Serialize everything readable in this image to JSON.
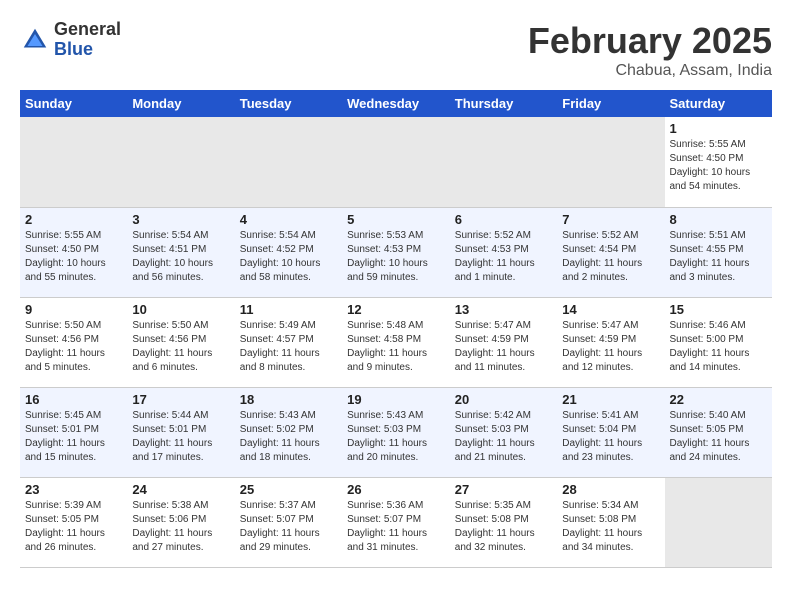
{
  "header": {
    "logo_general": "General",
    "logo_blue": "Blue",
    "month": "February 2025",
    "location": "Chabua, Assam, India"
  },
  "weekdays": [
    "Sunday",
    "Monday",
    "Tuesday",
    "Wednesday",
    "Thursday",
    "Friday",
    "Saturday"
  ],
  "weeks": [
    [
      {
        "day": "",
        "info": ""
      },
      {
        "day": "",
        "info": ""
      },
      {
        "day": "",
        "info": ""
      },
      {
        "day": "",
        "info": ""
      },
      {
        "day": "",
        "info": ""
      },
      {
        "day": "",
        "info": ""
      },
      {
        "day": "1",
        "info": "Sunrise: 5:55 AM\nSunset: 4:50 PM\nDaylight: 10 hours and 54 minutes."
      }
    ],
    [
      {
        "day": "2",
        "info": "Sunrise: 5:55 AM\nSunset: 4:50 PM\nDaylight: 10 hours and 55 minutes."
      },
      {
        "day": "3",
        "info": "Sunrise: 5:54 AM\nSunset: 4:51 PM\nDaylight: 10 hours and 56 minutes."
      },
      {
        "day": "4",
        "info": "Sunrise: 5:54 AM\nSunset: 4:52 PM\nDaylight: 10 hours and 58 minutes."
      },
      {
        "day": "5",
        "info": "Sunrise: 5:53 AM\nSunset: 4:53 PM\nDaylight: 10 hours and 59 minutes."
      },
      {
        "day": "6",
        "info": "Sunrise: 5:52 AM\nSunset: 4:53 PM\nDaylight: 11 hours and 1 minute."
      },
      {
        "day": "7",
        "info": "Sunrise: 5:52 AM\nSunset: 4:54 PM\nDaylight: 11 hours and 2 minutes."
      },
      {
        "day": "8",
        "info": "Sunrise: 5:51 AM\nSunset: 4:55 PM\nDaylight: 11 hours and 3 minutes."
      }
    ],
    [
      {
        "day": "9",
        "info": "Sunrise: 5:50 AM\nSunset: 4:56 PM\nDaylight: 11 hours and 5 minutes."
      },
      {
        "day": "10",
        "info": "Sunrise: 5:50 AM\nSunset: 4:56 PM\nDaylight: 11 hours and 6 minutes."
      },
      {
        "day": "11",
        "info": "Sunrise: 5:49 AM\nSunset: 4:57 PM\nDaylight: 11 hours and 8 minutes."
      },
      {
        "day": "12",
        "info": "Sunrise: 5:48 AM\nSunset: 4:58 PM\nDaylight: 11 hours and 9 minutes."
      },
      {
        "day": "13",
        "info": "Sunrise: 5:47 AM\nSunset: 4:59 PM\nDaylight: 11 hours and 11 minutes."
      },
      {
        "day": "14",
        "info": "Sunrise: 5:47 AM\nSunset: 4:59 PM\nDaylight: 11 hours and 12 minutes."
      },
      {
        "day": "15",
        "info": "Sunrise: 5:46 AM\nSunset: 5:00 PM\nDaylight: 11 hours and 14 minutes."
      }
    ],
    [
      {
        "day": "16",
        "info": "Sunrise: 5:45 AM\nSunset: 5:01 PM\nDaylight: 11 hours and 15 minutes."
      },
      {
        "day": "17",
        "info": "Sunrise: 5:44 AM\nSunset: 5:01 PM\nDaylight: 11 hours and 17 minutes."
      },
      {
        "day": "18",
        "info": "Sunrise: 5:43 AM\nSunset: 5:02 PM\nDaylight: 11 hours and 18 minutes."
      },
      {
        "day": "19",
        "info": "Sunrise: 5:43 AM\nSunset: 5:03 PM\nDaylight: 11 hours and 20 minutes."
      },
      {
        "day": "20",
        "info": "Sunrise: 5:42 AM\nSunset: 5:03 PM\nDaylight: 11 hours and 21 minutes."
      },
      {
        "day": "21",
        "info": "Sunrise: 5:41 AM\nSunset: 5:04 PM\nDaylight: 11 hours and 23 minutes."
      },
      {
        "day": "22",
        "info": "Sunrise: 5:40 AM\nSunset: 5:05 PM\nDaylight: 11 hours and 24 minutes."
      }
    ],
    [
      {
        "day": "23",
        "info": "Sunrise: 5:39 AM\nSunset: 5:05 PM\nDaylight: 11 hours and 26 minutes."
      },
      {
        "day": "24",
        "info": "Sunrise: 5:38 AM\nSunset: 5:06 PM\nDaylight: 11 hours and 27 minutes."
      },
      {
        "day": "25",
        "info": "Sunrise: 5:37 AM\nSunset: 5:07 PM\nDaylight: 11 hours and 29 minutes."
      },
      {
        "day": "26",
        "info": "Sunrise: 5:36 AM\nSunset: 5:07 PM\nDaylight: 11 hours and 31 minutes."
      },
      {
        "day": "27",
        "info": "Sunrise: 5:35 AM\nSunset: 5:08 PM\nDaylight: 11 hours and 32 minutes."
      },
      {
        "day": "28",
        "info": "Sunrise: 5:34 AM\nSunset: 5:08 PM\nDaylight: 11 hours and 34 minutes."
      },
      {
        "day": "",
        "info": ""
      }
    ]
  ]
}
